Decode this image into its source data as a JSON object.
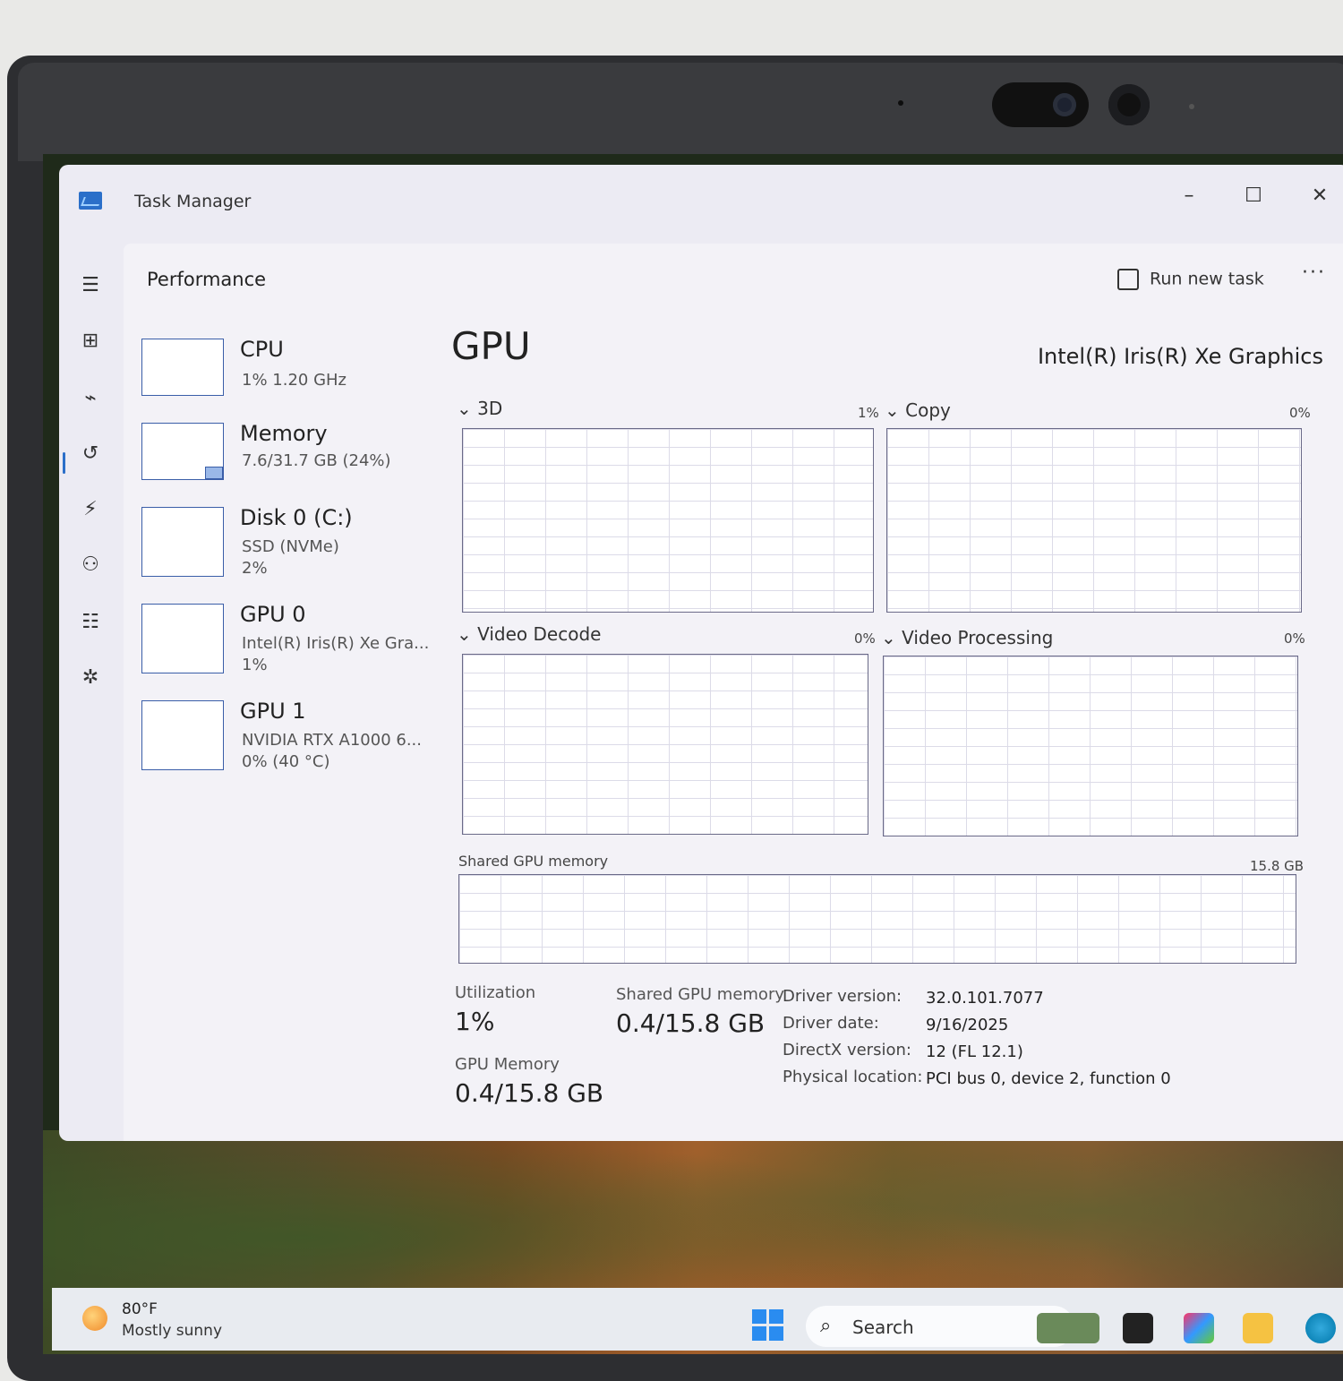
{
  "window": {
    "title": "Task Manager",
    "minimize": "–",
    "maximize": "☐",
    "close": "✕"
  },
  "header": {
    "page_title": "Performance",
    "run_task": "Run new task",
    "more": "···"
  },
  "resources": [
    {
      "name": "CPU",
      "sub1": "1%  1.20 GHz",
      "sub2": "",
      "sub3": ""
    },
    {
      "name": "Memory",
      "sub1": "7.6/31.7 GB (24%)",
      "sub2": "",
      "sub3": ""
    },
    {
      "name": "Disk 0 (C:)",
      "sub1": "SSD (NVMe)",
      "sub2": "2%",
      "sub3": ""
    },
    {
      "name": "GPU 0",
      "sub1": "Intel(R) Iris(R) Xe Gra...",
      "sub2": "1%",
      "sub3": ""
    },
    {
      "name": "GPU 1",
      "sub1": "NVIDIA RTX A1000 6...",
      "sub2": "0% (40 °C)",
      "sub3": ""
    }
  ],
  "gpu": {
    "heading": "GPU",
    "model": "Intel(R) Iris(R) Xe Graphics",
    "engines": [
      {
        "label": "3D",
        "pct": "1%"
      },
      {
        "label": "Copy",
        "pct": "0%"
      },
      {
        "label": "Video Decode",
        "pct": "0%"
      },
      {
        "label": "Video Processing",
        "pct": "0%"
      }
    ],
    "shared_label": "Shared GPU memory",
    "shared_max": "15.8 GB",
    "stats": {
      "utilization_label": "Utilization",
      "utilization_value": "1%",
      "shared_label": "Shared GPU memory",
      "shared_value": "0.4/15.8 GB",
      "gpu_mem_label": "GPU Memory",
      "gpu_mem_value": "0.4/15.8 GB"
    },
    "info": [
      {
        "key": "Driver version:",
        "value": "32.0.101.7077"
      },
      {
        "key": "Driver date:",
        "value": "9/16/2025"
      },
      {
        "key": "DirectX version:",
        "value": "12 (FL 12.1)"
      },
      {
        "key": "Physical location:",
        "value": "PCI bus 0, device 2, function 0"
      }
    ]
  },
  "taskbar": {
    "temp": "80°F",
    "condition": "Mostly sunny",
    "search": "Search"
  },
  "colors": {
    "accent": "#2b6fc9",
    "graph_border": "#6a6a88",
    "thumb_border": "#3a5ea8"
  }
}
